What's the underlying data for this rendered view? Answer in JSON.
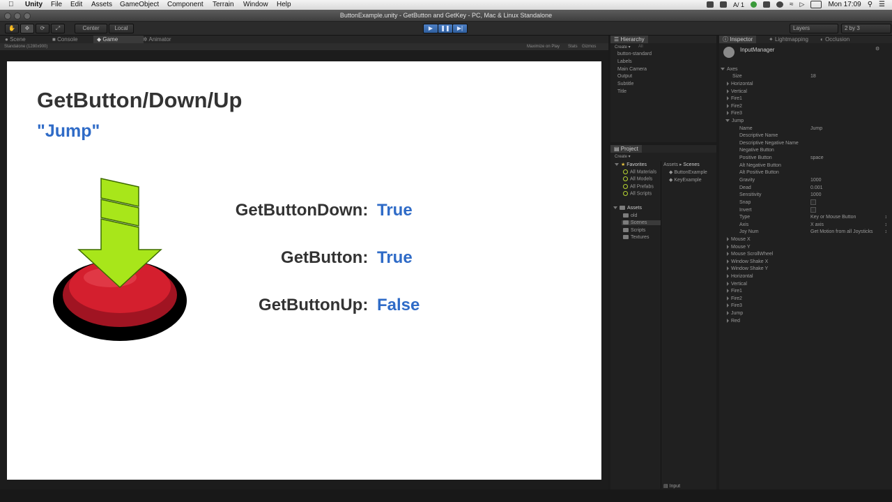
{
  "menubar": {
    "app": "Unity",
    "items": [
      "File",
      "Edit",
      "Assets",
      "GameObject",
      "Component",
      "Terrain",
      "Window",
      "Help"
    ],
    "clock": "Mon 17:09",
    "battery_indicator": "1"
  },
  "window": {
    "title": "ButtonExample.unity - GetButton and GetKey - PC, Mac & Linux Standalone"
  },
  "toolbar": {
    "pivot": "Center",
    "space": "Local",
    "layers": "Layers",
    "layout": "2 by 3"
  },
  "scene_tabs": [
    "Scene",
    "Console",
    "Game",
    "Animator"
  ],
  "game_bar": {
    "resolution": "Standalone (1280x900)",
    "maximize": "Maximize on Play",
    "stats": "Stats",
    "gizmos": "Gizmos"
  },
  "slide": {
    "title": "GetButton/Down/Up",
    "subtitle": "\"Jump\"",
    "rows": [
      {
        "label": "GetButtonDown:",
        "value": "True"
      },
      {
        "label": "GetButton:",
        "value": "True"
      },
      {
        "label": "GetButtonUp:",
        "value": "False"
      }
    ]
  },
  "hierarchy": {
    "tab": "Hierarchy",
    "create": "Create",
    "search": "All",
    "items": [
      "button-standard",
      "Labels",
      "Main Camera",
      "Output",
      "Subtitle",
      "Title"
    ]
  },
  "project": {
    "tab": "Project",
    "create": "Create",
    "favorites_label": "Favorites",
    "favorites": [
      "All Materials",
      "All Models",
      "All Prefabs",
      "All Scripts"
    ],
    "assets_label": "Assets",
    "assets": [
      "old",
      "Scenes",
      "Scripts",
      "Textures"
    ],
    "breadcrumb": [
      "Assets",
      "Scenes"
    ],
    "files": [
      "ButtonExample",
      "KeyExample"
    ],
    "footer": "Input"
  },
  "inspector": {
    "tabs": [
      "Inspector",
      "Lightmapping",
      "Occlusion"
    ],
    "component": "InputManager",
    "axes_label": "Axes",
    "size_label": "Size",
    "size_value": "18",
    "axes_before": [
      "Horizontal",
      "Vertical",
      "Fire1",
      "Fire2",
      "Fire3"
    ],
    "jump_label": "Jump",
    "jump_props": [
      {
        "label": "Name",
        "value": "Jump"
      },
      {
        "label": "Descriptive Name",
        "value": ""
      },
      {
        "label": "Descriptive Negative Name",
        "value": ""
      },
      {
        "label": "Negative Button",
        "value": ""
      },
      {
        "label": "Positive Button",
        "value": "space"
      },
      {
        "label": "Alt Negative Button",
        "value": ""
      },
      {
        "label": "Alt Positive Button",
        "value": ""
      },
      {
        "label": "Gravity",
        "value": "1000"
      },
      {
        "label": "Dead",
        "value": "0.001"
      },
      {
        "label": "Sensitivity",
        "value": "1000"
      },
      {
        "label": "Snap",
        "value": ""
      },
      {
        "label": "Invert",
        "value": ""
      },
      {
        "label": "Type",
        "value": "Key or Mouse Button"
      },
      {
        "label": "Axis",
        "value": "X axis"
      },
      {
        "label": "Joy Num",
        "value": "Get Motion from all Joysticks"
      }
    ],
    "axes_after": [
      "Mouse X",
      "Mouse Y",
      "Mouse ScrollWheel",
      "Window Shake X",
      "Window Shake Y",
      "Horizontal",
      "Vertical",
      "Fire1",
      "Fire2",
      "Fire3",
      "Jump",
      "Red"
    ]
  }
}
